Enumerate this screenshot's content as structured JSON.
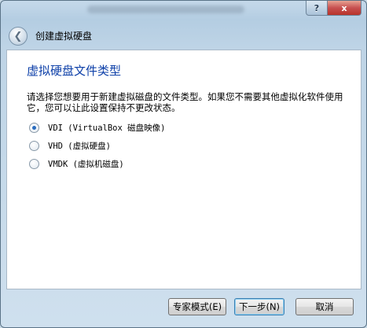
{
  "window": {
    "help_glyph": "?",
    "close_glyph": "x"
  },
  "header": {
    "wizard_title": "创建虚拟硬盘",
    "back_glyph": "❮"
  },
  "page": {
    "title": "虚拟硬盘文件类型",
    "description": "请选择您想要用于新建虚拟磁盘的文件类型。如果您不需要其他虚拟化软件使用它，您可以让此设置保持不更改状态。"
  },
  "options": [
    {
      "label": "VDI (VirtualBox 磁盘映像)",
      "selected": true
    },
    {
      "label": "VHD (虚拟硬盘)",
      "selected": false
    },
    {
      "label": "VMDK (虚拟机磁盘)",
      "selected": false
    }
  ],
  "buttons": {
    "expert": "专家模式(E)",
    "next": "下一步(N)",
    "cancel": "取消"
  }
}
